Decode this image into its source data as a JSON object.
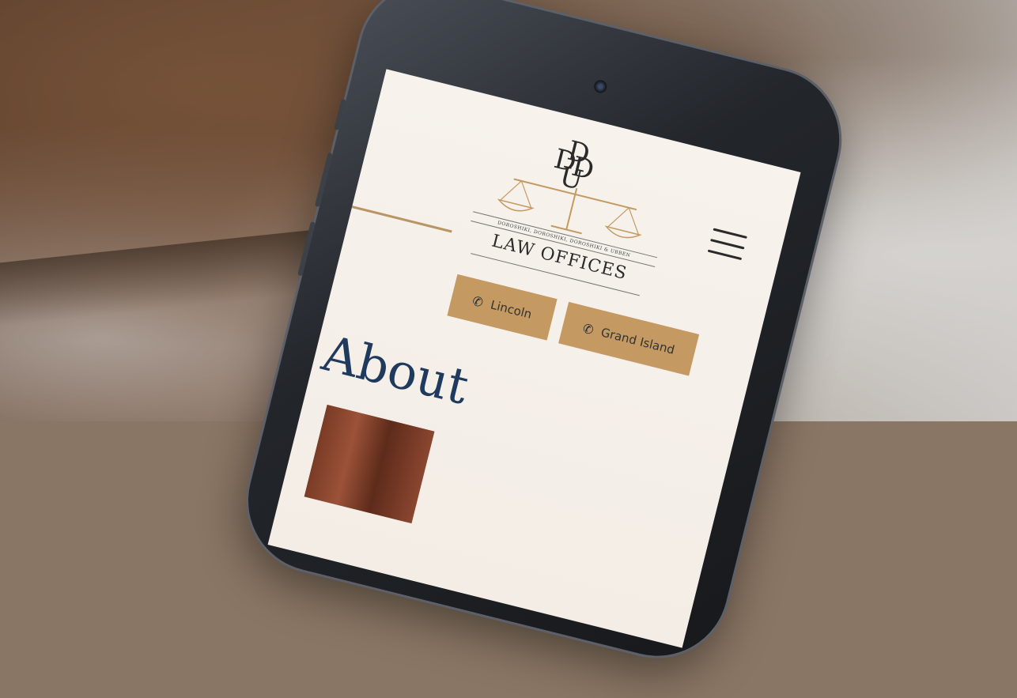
{
  "logo": {
    "monogram": [
      "D",
      "D",
      "D",
      "U"
    ],
    "firm_name": "DOROSHIKI, DOROSHIKI, DOROSHIKI & UBBEN",
    "title": "LAW OFFICES"
  },
  "menu_icon": "hamburger-menu-icon",
  "buttons": [
    {
      "label": "Lincoln",
      "icon": "phone-icon"
    },
    {
      "label": "Grand Island",
      "icon": "phone-icon"
    }
  ],
  "heading": "About",
  "colors": {
    "accent": "#c49a62",
    "heading": "#1f3a5c",
    "screen_bg": "#f7f2ec"
  }
}
